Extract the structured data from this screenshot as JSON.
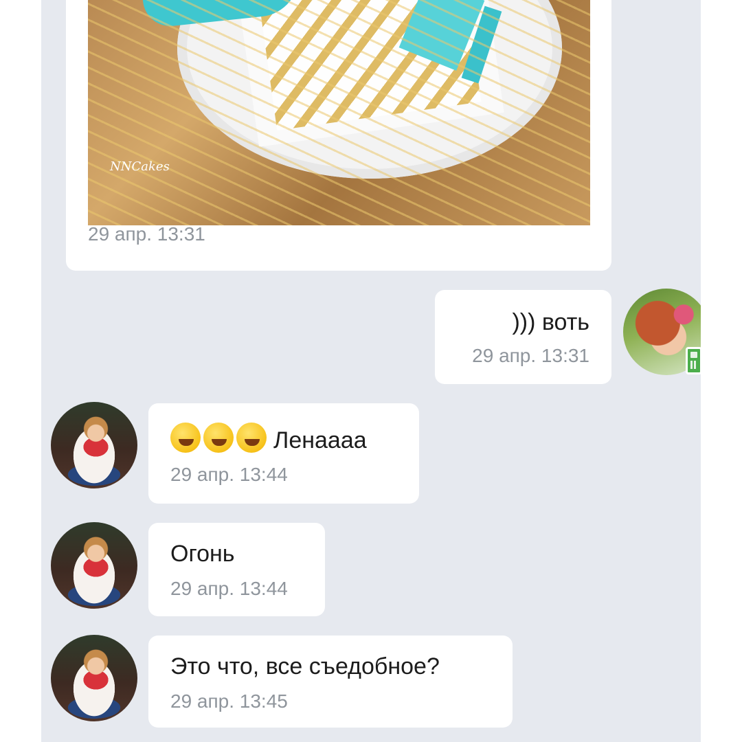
{
  "messages": {
    "photo": {
      "watermark": "NNCakes",
      "time": "29 апр. 13:31"
    },
    "outgoing": {
      "text": "))) воть",
      "time": "29 апр. 13:31"
    },
    "incoming": [
      {
        "emoji": "🤣🤣🤣",
        "text": "Ленаааа",
        "time": "29 апр. 13:44"
      },
      {
        "text": "Огонь",
        "time": "29 апр. 13:44"
      },
      {
        "text": "Это что, все съедобное?",
        "time": "29 апр. 13:45"
      }
    ]
  },
  "icons": {
    "online_status": "mobile-phone-icon",
    "emoji": "rolling-on-floor-laughing-emoji"
  },
  "colors": {
    "chat_background": "#e6e9ef",
    "bubble": "#ffffff",
    "time_text": "#8f959c",
    "mobile_status": "#4cae4c"
  }
}
